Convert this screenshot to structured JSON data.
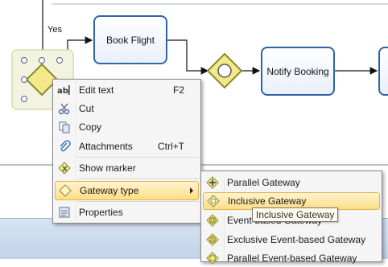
{
  "diagram": {
    "tasks": [
      {
        "name": "book-flight-task",
        "label": "Book Flight"
      },
      {
        "name": "notify-booking-task",
        "label": "Notify Booking"
      }
    ],
    "flow_label_yes": "Yes"
  },
  "context_menu": {
    "items": [
      {
        "name": "menu-edit-text",
        "icon": "edit-text-icon",
        "label": "Edit text",
        "shortcut": "F2"
      },
      {
        "name": "menu-cut",
        "icon": "scissors-icon",
        "label": "Cut",
        "shortcut": ""
      },
      {
        "name": "menu-copy",
        "icon": "copy-icon",
        "label": "Copy",
        "shortcut": ""
      },
      {
        "name": "menu-attachments",
        "icon": "paperclip-icon",
        "label": "Attachments",
        "shortcut": "Ctrl+T"
      },
      {
        "name": "menu-show-marker",
        "icon": "marker-icon",
        "label": "Show marker",
        "shortcut": ""
      },
      {
        "name": "menu-gateway-type",
        "icon": "gateway-diamond-icon",
        "label": "Gateway type",
        "shortcut": ""
      },
      {
        "name": "menu-properties",
        "icon": "properties-icon",
        "label": "Properties",
        "shortcut": ""
      }
    ]
  },
  "submenu": {
    "items": [
      {
        "name": "submenu-parallel-gateway",
        "icon": "parallel-gateway-icon",
        "label": "Parallel Gateway"
      },
      {
        "name": "submenu-inclusive-gateway",
        "icon": "inclusive-gateway-icon",
        "label": "Inclusive Gateway"
      },
      {
        "name": "submenu-event-based-gateway",
        "icon": "event-based-gateway-icon",
        "label": "Event-based Gateway"
      },
      {
        "name": "submenu-exclusive-event-based-gateway",
        "icon": "exclusive-event-based-gateway-icon",
        "label": "Exclusive Event-based Gateway"
      },
      {
        "name": "submenu-parallel-event-based-gateway",
        "icon": "parallel-event-based-gateway-icon",
        "label": "Parallel Event-based Gateway"
      }
    ]
  },
  "tooltip": {
    "text": "Inclusive Gateway"
  },
  "colors": {
    "task_border": "#2f64a6",
    "gateway_fill": "#f3e98a",
    "gateway_border": "#8a8a2a",
    "menu_highlight": "#fedf86"
  }
}
